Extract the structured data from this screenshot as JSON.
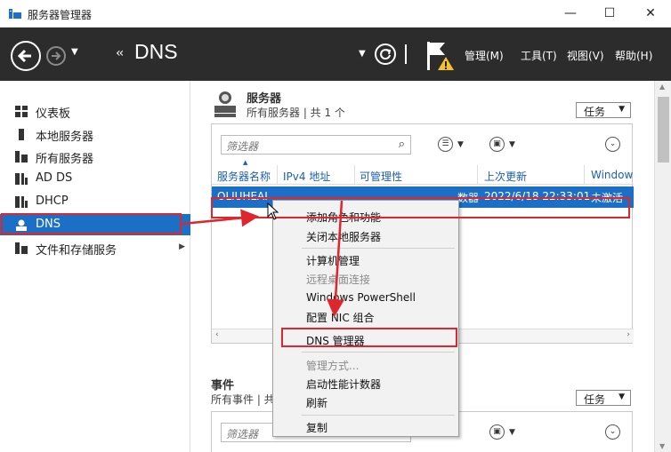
{
  "window": {
    "title": "服务器管理器",
    "controls": [
      "—",
      "☐",
      "✕"
    ]
  },
  "header": {
    "breadcrumb_arrows": "‹‹",
    "breadcrumb": "DNS",
    "menus": [
      "管理(M)",
      "工具(T)",
      "视图(V)",
      "帮助(H)"
    ]
  },
  "sidebar": {
    "items": [
      {
        "label": "仪表板",
        "icon": "dashboard-icon"
      },
      {
        "label": "本地服务器",
        "icon": "local-server-icon"
      },
      {
        "label": "所有服务器",
        "icon": "all-servers-icon"
      },
      {
        "label": "AD DS",
        "icon": "adds-icon"
      },
      {
        "label": "DHCP",
        "icon": "dhcp-icon"
      },
      {
        "label": "DNS",
        "icon": "dns-icon",
        "selected": true
      },
      {
        "label": "文件和存储服务",
        "icon": "file-storage-icon",
        "expandable": true
      }
    ]
  },
  "servers_section": {
    "title": "服务器",
    "subtitle": "所有服务器 | 共 1 个",
    "tasks_label": "任务",
    "filter_placeholder": "筛选器",
    "columns": [
      "服务器名称",
      "IPv4 地址",
      "可管理性",
      "上次更新",
      "Window"
    ],
    "selected_row": {
      "name": "OLIUHEAI",
      "manageability_fragment": "数器",
      "last_update": "2022/6/18 22:33:01",
      "activation": "未激活"
    }
  },
  "events_section": {
    "title": "事件",
    "subtitle": "所有事件 | 共",
    "tasks_label": "任务",
    "filter_placeholder": "筛选器"
  },
  "context_menu": {
    "items": [
      {
        "label": "添加角色和功能",
        "enabled": true
      },
      {
        "label": "关闭本地服务器",
        "enabled": true
      },
      {
        "separator": true
      },
      {
        "label": "计算机管理",
        "enabled": true
      },
      {
        "label": "远程桌面连接",
        "enabled": false
      },
      {
        "label": "Windows PowerShell",
        "enabled": true
      },
      {
        "label": "配置 NIC 组合",
        "enabled": true
      },
      {
        "label": "DNS 管理器",
        "enabled": true,
        "highlighted": true
      },
      {
        "separator": true
      },
      {
        "label": "管理方式...",
        "enabled": false
      },
      {
        "label": "启动性能计数器",
        "enabled": true
      },
      {
        "label": "刷新",
        "enabled": true
      },
      {
        "separator": true
      },
      {
        "label": "复制",
        "enabled": true
      }
    ]
  },
  "colors": {
    "header_bg": "#2c2c2c",
    "selection": "#1c6fc7",
    "annotation_red": "#e0262d",
    "link_blue": "#1a5fb4"
  }
}
